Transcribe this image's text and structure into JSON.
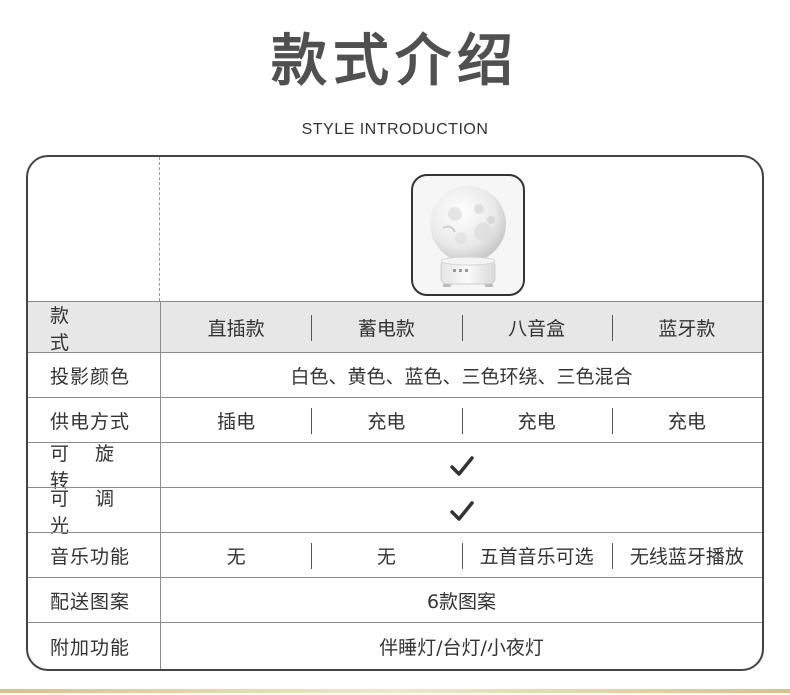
{
  "title": "款式介绍",
  "subtitle": "STYLE INTRODUCTION",
  "table": {
    "header": {
      "label": "款　　式",
      "columns": [
        "直插款",
        "蓄电款",
        "八音盒",
        "蓝牙款"
      ]
    },
    "rows": {
      "projection": {
        "label": "投影颜色",
        "value": "白色、黄色、蓝色、三色环绕、三色混合"
      },
      "power": {
        "label": "供电方式",
        "values": [
          "插电",
          "充电",
          "充电",
          "充电"
        ]
      },
      "rotate": {
        "label": "可 旋 转",
        "icon": "checkmark-icon"
      },
      "dimmable": {
        "label": "可 调 光",
        "icon": "checkmark-icon"
      },
      "music": {
        "label": "音乐功能",
        "values": [
          "无",
          "无",
          "五首音乐可选",
          "无线蓝牙播放"
        ]
      },
      "patterns": {
        "label": "配送图案",
        "value": "6款图案"
      },
      "extra": {
        "label": "附加功能",
        "value": "伴睡灯/台灯/小夜灯"
      }
    }
  },
  "colors": {
    "header_bg": "#e7e7e7",
    "border": "#444444",
    "accent_bottom": "#d8c28a"
  }
}
